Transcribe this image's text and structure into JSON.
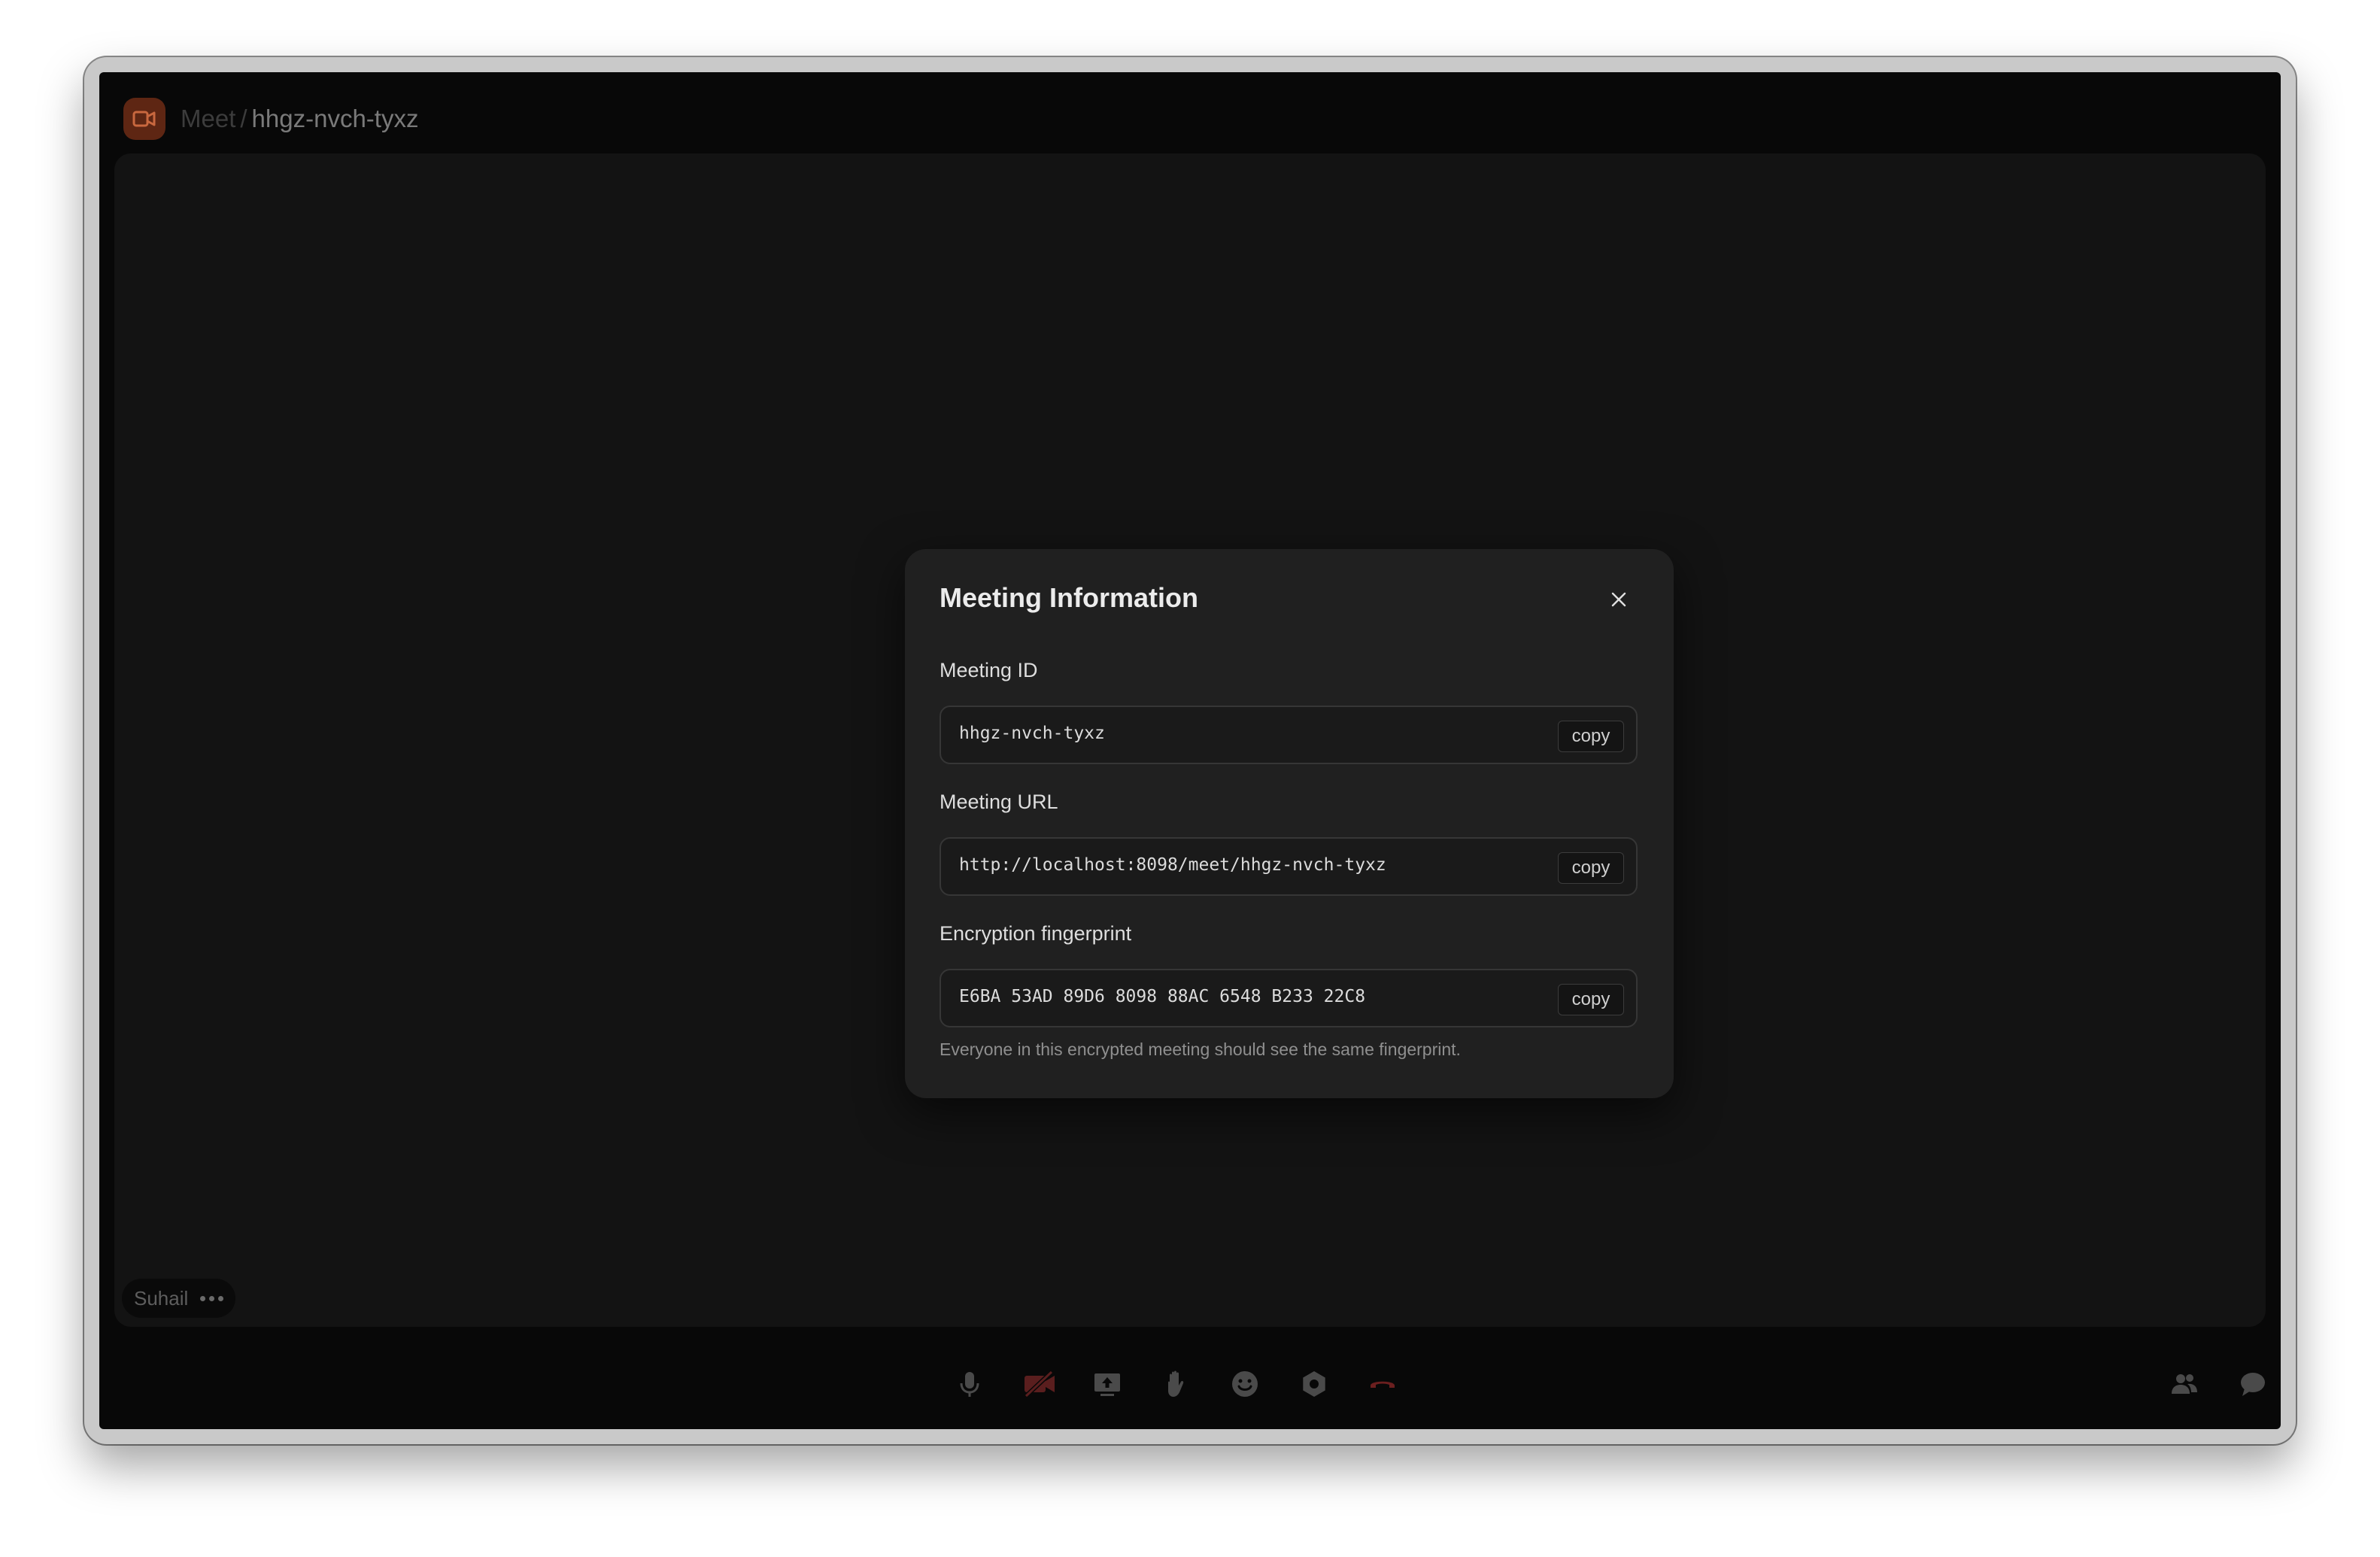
{
  "breadcrumb": {
    "root": "Meet",
    "separator": "/",
    "current": "hhgz-nvch-tyxz"
  },
  "participant": {
    "name": "Suhail"
  },
  "modal": {
    "title": "Meeting Information",
    "fields": [
      {
        "label": "Meeting ID",
        "value": "hhgz-nvch-tyxz",
        "copy_label": "copy"
      },
      {
        "label": "Meeting URL",
        "value": "http://localhost:8098/meet/hhgz-nvch-tyxz",
        "copy_label": "copy"
      },
      {
        "label": "Encryption fingerprint",
        "value": "E6BA 53AD 89D6 8098 88AC 6548 B233 22C8",
        "copy_label": "copy"
      }
    ],
    "hint": "Everyone in this encrypted meeting should see the same fingerprint."
  },
  "toolbar": {
    "icons": [
      "microphone-icon",
      "camera-off-icon",
      "screen-share-icon",
      "raise-hand-icon",
      "emoji-icon",
      "settings-icon",
      "hang-up-icon",
      "participants-icon",
      "chat-icon"
    ]
  },
  "colors": {
    "accent": "#5e2613",
    "camera_off": "#5a1e1e",
    "hang_up": "#6b1f1f",
    "modal_bg": "#202020",
    "stage_bg": "#131313"
  }
}
